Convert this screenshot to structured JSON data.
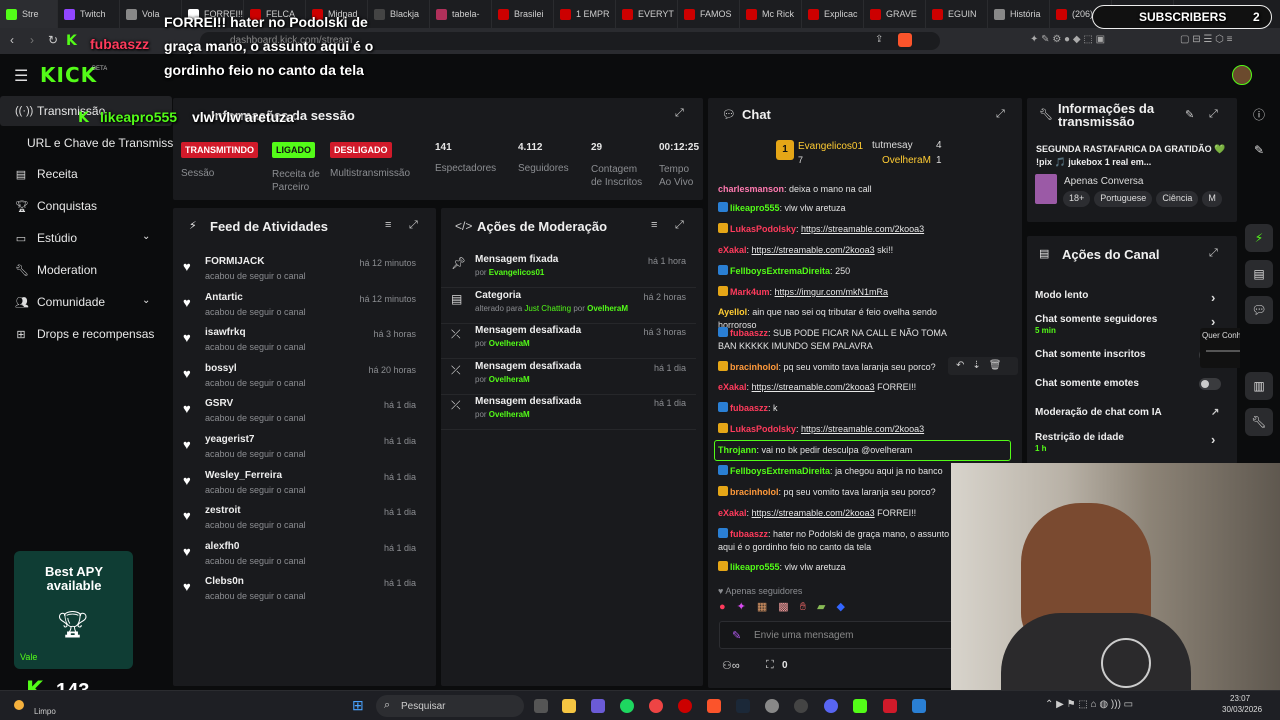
{
  "browser": {
    "tabs": [
      {
        "label": "Stre",
        "color": "#53fc18"
      },
      {
        "label": "Twitch",
        "color": "#9146ff"
      },
      {
        "label": "Vola",
        "color": "#888888"
      },
      {
        "label": "FORREI!!",
        "color": "#ffffff"
      },
      {
        "label": "FELCA",
        "color": "#cc0000"
      },
      {
        "label": "Midpad",
        "color": "#cc0000"
      },
      {
        "label": "Blackja",
        "color": "#444444"
      },
      {
        "label": "tabela-",
        "color": "#b0305a"
      },
      {
        "label": "Brasilei",
        "color": "#cc0000"
      },
      {
        "label": "1 EMPR",
        "color": "#cc0000"
      },
      {
        "label": "EVERYT",
        "color": "#cc0000"
      },
      {
        "label": "FAMOS",
        "color": "#cc0000"
      },
      {
        "label": "Mc Rick",
        "color": "#cc0000"
      },
      {
        "label": "Explicac",
        "color": "#cc0000"
      },
      {
        "label": "GRAVE",
        "color": "#cc0000"
      },
      {
        "label": "EGUIN",
        "color": "#cc0000"
      },
      {
        "label": "História",
        "color": "#888888"
      },
      {
        "label": "(206) Ja",
        "color": "#cc0000"
      },
      {
        "label": "saq ip",
        "color": "#888888"
      }
    ],
    "url": "dashboard.kick.com/stream"
  },
  "overlay": {
    "subscribers_label": "SUBSCRIBERS",
    "subscribers_count": "2",
    "chat_user": "fubaaszz",
    "chat_text": "FORREI!! hater no Podolski de graça mano, o assunto aqui é o gordinho feio no canto da tela",
    "chat_user2": "likeapro555",
    "chat_text2": "vlw vlw aretuza",
    "follower_count": "143",
    "weather": "Limpo",
    "best_apy": "Best APY available",
    "vale": "Vale"
  },
  "header": {
    "logo": "KICK",
    "beta": "BETA"
  },
  "sidebar": {
    "items": [
      {
        "label": "Transmissão",
        "icon": "broadcast-icon"
      },
      {
        "label": "URL e Chave de Transmissão",
        "icon": ""
      },
      {
        "label": "Receita",
        "icon": "dollar-icon"
      },
      {
        "label": "Conquistas",
        "icon": "trophy-icon"
      },
      {
        "label": "Estúdio",
        "icon": "studio-icon"
      },
      {
        "label": "Moderation",
        "icon": "wrench-icon"
      },
      {
        "label": "Comunidade",
        "icon": "people-icon"
      },
      {
        "label": "Drops e recompensas",
        "icon": "gift-icon"
      }
    ]
  },
  "session": {
    "title": "Informações da sessão",
    "stats": [
      {
        "badge": "TRANSMITINDO",
        "badge_color": "#d11a2a",
        "label": "Sessão"
      },
      {
        "badge": "LIGADO",
        "badge_color": "#53fc18",
        "label": "Receita de Parceiro"
      },
      {
        "badge": "DESLIGADO",
        "badge_color": "#d11a2a",
        "label": "Multistransmissão"
      },
      {
        "value": "141",
        "label": "Espectadores"
      },
      {
        "value": "4.112",
        "label": "Seguidores"
      },
      {
        "value": "29",
        "label": "Contagem de Inscritos"
      },
      {
        "value": "00:12:25",
        "label": "Tempo Ao Vivo"
      }
    ]
  },
  "feed": {
    "title": "Feed de Atividades",
    "items": [
      {
        "name": "FORMIJACK",
        "sub": "acabou de seguir o canal",
        "time": "há 12 minutos"
      },
      {
        "name": "Antartic",
        "sub": "acabou de seguir o canal",
        "time": "há 12 minutos"
      },
      {
        "name": "isawfrkq",
        "sub": "acabou de seguir o canal",
        "time": "há 3 horas"
      },
      {
        "name": "bossyl",
        "sub": "acabou de seguir o canal",
        "time": "há 20 horas"
      },
      {
        "name": "GSRV",
        "sub": "acabou de seguir o canal",
        "time": "há 1 dia"
      },
      {
        "name": "yeagerist7",
        "sub": "acabou de seguir o canal",
        "time": "há 1 dia"
      },
      {
        "name": "Wesley_Ferreira",
        "sub": "acabou de seguir o canal",
        "time": "há 1 dia"
      },
      {
        "name": "zestroit",
        "sub": "acabou de seguir o canal",
        "time": "há 1 dia"
      },
      {
        "name": "alexfh0",
        "sub": "acabou de seguir o canal",
        "time": "há 1 dia"
      },
      {
        "name": "Clebs0n",
        "sub": "acabou de seguir o canal",
        "time": "há 1 dia"
      }
    ]
  },
  "moderation": {
    "title": "Ações de Moderação",
    "items": [
      {
        "name": "Mensagem fixada",
        "pre": "por",
        "by": "Evangelicos01",
        "time": "há 1 hora",
        "icon": "pin-icon"
      },
      {
        "name": "Categoria",
        "pre": "alterado para",
        "cat": "Just Chatting",
        "mid": "por",
        "by": "OvelheraM",
        "time": "há 2 horas",
        "icon": "category-icon"
      },
      {
        "name": "Mensagem desafixada",
        "pre": "por",
        "by": "OvelheraM",
        "time": "há 3 horas",
        "icon": "unpin-icon"
      },
      {
        "name": "Mensagem desafixada",
        "pre": "por",
        "by": "OvelheraM",
        "time": "há 1 dia",
        "icon": "unpin-icon"
      },
      {
        "name": "Mensagem desafixada",
        "pre": "por",
        "by": "OvelheraM",
        "time": "há 1 dia",
        "icon": "unpin-icon"
      }
    ]
  },
  "chat": {
    "title": "Chat",
    "top": {
      "first": "Evangelicos01",
      "first_count": "7",
      "second": "tutmesay",
      "second_count": "4",
      "third": "OvelheraM",
      "third_count": "1"
    },
    "messages": [
      {
        "user": "charlesmanson",
        "text": "deixa o mano na call",
        "color": "#ff7ab0"
      },
      {
        "user": "likeapro555",
        "text": "vlw vlw aretuza",
        "color": "#53fc18"
      },
      {
        "user": "LukasPodolsky",
        "link": "https://streamable.com/2kooa3",
        "text": "",
        "color": "#ff3b5c"
      },
      {
        "user": "eXakal",
        "link": "https://streamable.com/2kooa3",
        "text": "ski!!",
        "color": "#ff3b5c"
      },
      {
        "user": "FellboysExtremaDireita",
        "text": "250",
        "color": "#53fc18"
      },
      {
        "user": "Mark4um",
        "link": "https://imgur.com/mkN1mRa",
        "text": "",
        "color": "#ff3b5c"
      },
      {
        "user": "Ayellol",
        "text": "ain que nao sei oq tributar é feio ovelha sendo horroroso",
        "color": "#ffcc33"
      },
      {
        "user": "fubaaszz",
        "text": "SUB PODE FICAR NA CALL E NÃO TOMA BAN KKKKK IMUNDO SEM PALAVRA",
        "color": "#ff3b5c"
      },
      {
        "user": "bracinholol",
        "text": "pq seu vomito tava laranja seu porco?",
        "color": "#ff9a3b"
      },
      {
        "user": "eXakal",
        "link": "https://streamable.com/2kooa3",
        "text": "FORREI!!",
        "color": "#ff3b5c"
      },
      {
        "user": "fubaaszz",
        "text": "k",
        "color": "#ff3b5c"
      },
      {
        "user": "LukasPodolsky",
        "link": "https://streamable.com/2kooa3",
        "text": "",
        "color": "#ff3b5c"
      },
      {
        "user": "Throjann",
        "text": "vai no bk pedir desculpa @ovelheram",
        "color": "#53fc18"
      },
      {
        "user": "FellboysExtremaDireita",
        "text": "ja chegou aqui ja no banco",
        "color": "#53fc18"
      },
      {
        "user": "bracinholol",
        "text": "pq seu vomito tava laranja seu porco?",
        "color": "#ff9a3b"
      },
      {
        "user": "eXakal",
        "link": "https://streamable.com/2kooa3",
        "text": "FORREI!!",
        "color": "#ff3b5c"
      },
      {
        "user": "fubaaszz",
        "text": "hater no Podolski de graça mano, o assunto aqui é o gordinho feio no canto da tela",
        "color": "#ff3b5c"
      },
      {
        "user": "likeapro555",
        "text": "vlw vlw aretuza",
        "color": "#53fc18"
      }
    ],
    "followers_only": "Apenas seguidores",
    "input_placeholder": "Envie uma mensagem",
    "footer_count": "0"
  },
  "stream_info": {
    "title": "Informações da transmissão",
    "stream_title": "SEGUNDA RASTAFARICA DA GRATIDÃO 💚 !pix 🎵 jukebox 1 real em...",
    "category": "Apenas Conversa",
    "tags": [
      "18+",
      "Portuguese",
      "Ciência",
      "M"
    ]
  },
  "channel_actions": {
    "title": "Ações do Canal",
    "items": [
      {
        "label": "Modo lento",
        "sub": ""
      },
      {
        "label": "Chat somente seguidores",
        "sub": "5 min"
      },
      {
        "label": "Chat somente inscritos",
        "sub": ""
      },
      {
        "label": "Chat somente emotes",
        "sub": ""
      },
      {
        "label": "Moderação de chat com IA",
        "sub": ""
      },
      {
        "label": "Restrição de idade",
        "sub": "1 h"
      }
    ],
    "popup": "Quer Conhecer S..."
  },
  "taskbar": {
    "search": "Pesquisar",
    "time": "23:07",
    "date": "30/03/2026"
  }
}
